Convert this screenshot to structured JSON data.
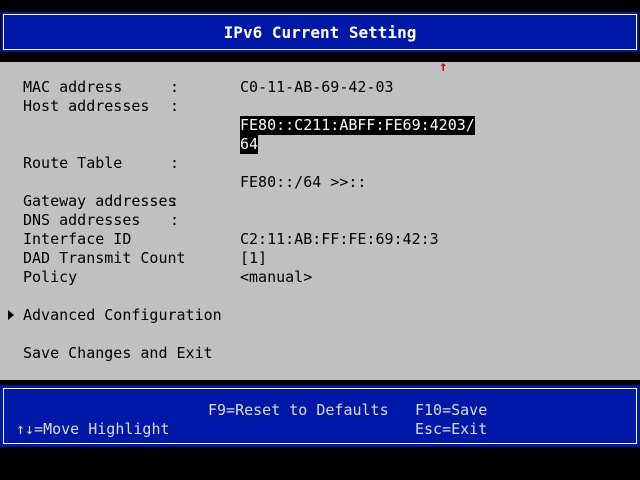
{
  "title": "IPv6 Current Setting",
  "fields": {
    "mac": {
      "label": "MAC address",
      "value": "C0-11-AB-69-42-03"
    },
    "host": {
      "label": "Host addresses",
      "value_line1": "FE80::C211:ABFF:FE69:4203/",
      "value_line2": "64"
    },
    "route": {
      "label": "Route Table",
      "value": "FE80::/64 >>::"
    },
    "gateway": {
      "label": "Gateway addresses"
    },
    "dns": {
      "label": "DNS addresses"
    },
    "iface": {
      "label": "Interface ID",
      "value": "C2:11:AB:FF:FE:69:42:3"
    },
    "dad": {
      "label": "DAD Transmit Count",
      "value": "[1]"
    },
    "policy": {
      "label": "Policy",
      "value": "<manual>"
    }
  },
  "colon": ":",
  "menu": {
    "advanced": "Advanced Configuration",
    "save_exit": "Save Changes and Exit"
  },
  "scroll_up_icon": "↑",
  "footer": {
    "move": "↑↓=Move Highlight",
    "reset": "F9=Reset to Defaults",
    "save": "F10=Save",
    "exit": "Esc=Exit"
  },
  "colors": {
    "bar_blue": "#0018a8",
    "panel_gray": "#c0c0c0",
    "arrow_red": "#e00000"
  }
}
